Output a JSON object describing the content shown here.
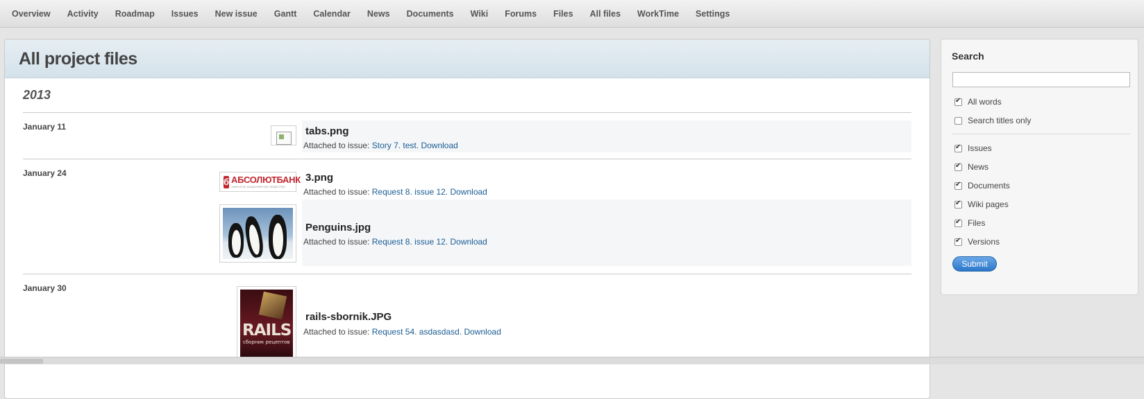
{
  "nav": [
    {
      "id": "overview",
      "label": "Overview"
    },
    {
      "id": "activity",
      "label": "Activity"
    },
    {
      "id": "roadmap",
      "label": "Roadmap"
    },
    {
      "id": "issues",
      "label": "Issues"
    },
    {
      "id": "new-issue",
      "label": "New issue"
    },
    {
      "id": "gantt",
      "label": "Gantt"
    },
    {
      "id": "calendar",
      "label": "Calendar"
    },
    {
      "id": "news",
      "label": "News"
    },
    {
      "id": "documents",
      "label": "Documents"
    },
    {
      "id": "wiki",
      "label": "Wiki"
    },
    {
      "id": "forums",
      "label": "Forums"
    },
    {
      "id": "files",
      "label": "Files"
    },
    {
      "id": "all-files",
      "label": "All files"
    },
    {
      "id": "worktime",
      "label": "WorkTime"
    },
    {
      "id": "settings",
      "label": "Settings"
    }
  ],
  "page": {
    "title": "All project files",
    "year": "2013"
  },
  "groups": [
    {
      "date": "January 11",
      "files": [
        {
          "name": "tabs.png",
          "attached_prefix": "Attached to issue:",
          "issue_link": "Story 7. test.",
          "download": "Download",
          "thumb": "broken-image-icon"
        }
      ]
    },
    {
      "date": "January 24",
      "files": [
        {
          "name": "3.png",
          "attached_prefix": "Attached to issue:",
          "issue_link": "Request 8. issue 12.",
          "download": "Download",
          "thumb": "bank-logo",
          "thumb_title": "АБСОЛЮТБАНК",
          "thumb_sub": "ЗАКРЫТОЕ АКЦИОНЕРНОЕ ОБЩЕСТВО"
        },
        {
          "name": "Penguins.jpg",
          "attached_prefix": "Attached to issue:",
          "issue_link": "Request 8. issue 12.",
          "download": "Download",
          "thumb": "penguins-photo"
        }
      ]
    },
    {
      "date": "January 30",
      "files": [
        {
          "name": "rails-sbornik.JPG",
          "attached_prefix": "Attached to issue:",
          "issue_link": "Request 54. asdasdasd.",
          "download": "Download",
          "thumb": "rails-book-cover",
          "thumb_title": "RAILS",
          "thumb_sub": "сборник рецептов"
        }
      ]
    }
  ],
  "sidebar": {
    "title": "Search",
    "search_value": "",
    "options_top": [
      {
        "label": "All words",
        "checked": true
      },
      {
        "label": "Search titles only",
        "checked": false
      }
    ],
    "options_scope": [
      {
        "label": "Issues",
        "checked": true
      },
      {
        "label": "News",
        "checked": true
      },
      {
        "label": "Documents",
        "checked": true
      },
      {
        "label": "Wiki pages",
        "checked": true
      },
      {
        "label": "Files",
        "checked": true
      },
      {
        "label": "Versions",
        "checked": true
      }
    ],
    "submit_label": "Submit"
  },
  "colors": {
    "link": "#1a5c93",
    "header_bg": "#d4e2ea",
    "submit": "#2b77c9"
  }
}
